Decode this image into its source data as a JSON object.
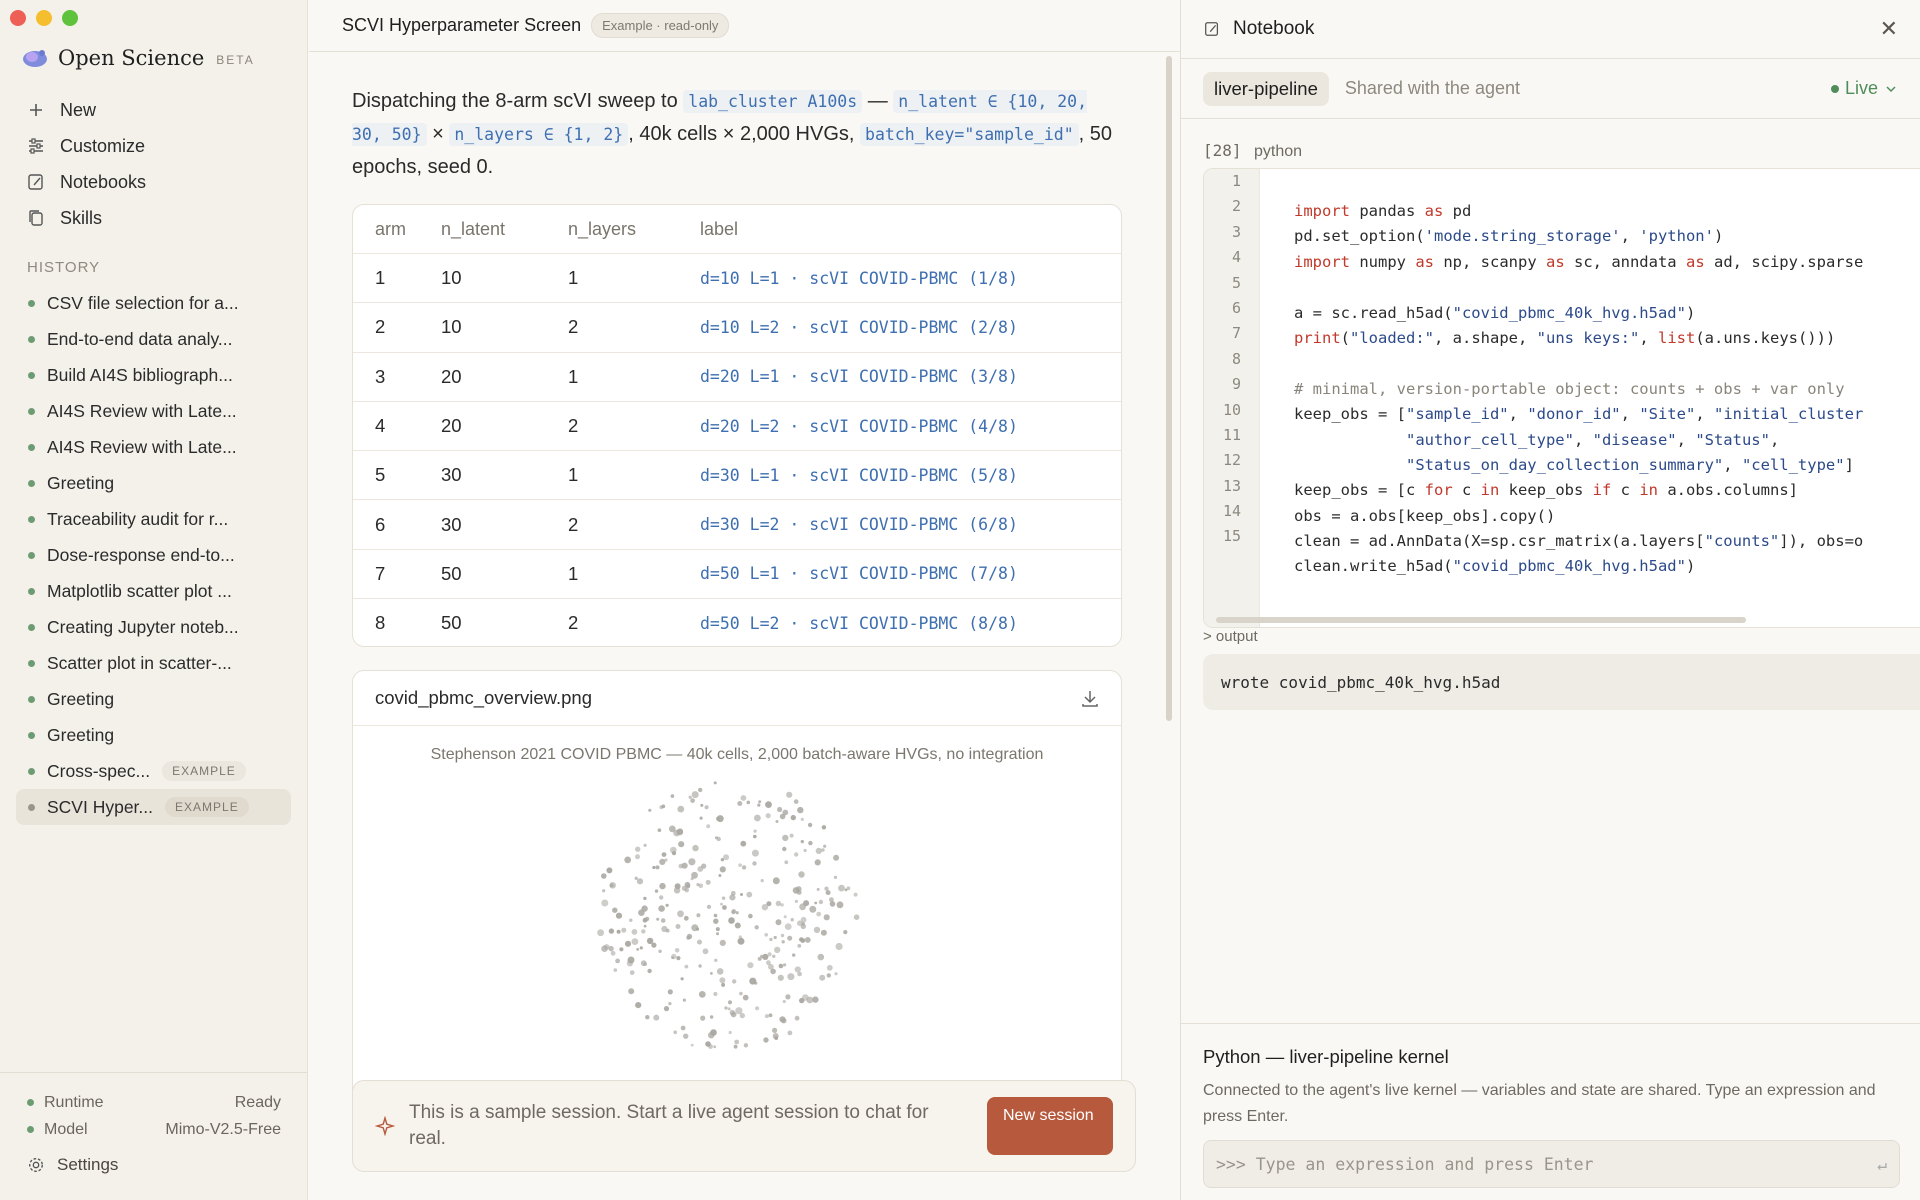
{
  "sidebar": {
    "brand": "Open Science",
    "brand_badge": "BETA",
    "nav": {
      "new": "New",
      "customize": "Customize",
      "notebooks": "Notebooks",
      "skills": "Skills"
    },
    "history_title": "HISTORY",
    "history": [
      {
        "label": "CSV file selection for a...",
        "tag": ""
      },
      {
        "label": "End-to-end data analy...",
        "tag": ""
      },
      {
        "label": "Build AI4S bibliograph...",
        "tag": ""
      },
      {
        "label": "AI4S Review with Late...",
        "tag": ""
      },
      {
        "label": "AI4S Review with Late...",
        "tag": ""
      },
      {
        "label": "Greeting",
        "tag": ""
      },
      {
        "label": "Traceability audit for r...",
        "tag": ""
      },
      {
        "label": "Dose-response end-to...",
        "tag": ""
      },
      {
        "label": "Matplotlib scatter plot ...",
        "tag": ""
      },
      {
        "label": "Creating Jupyter noteb...",
        "tag": ""
      },
      {
        "label": "Scatter plot in scatter-...",
        "tag": ""
      },
      {
        "label": "Greeting",
        "tag": ""
      },
      {
        "label": "Greeting",
        "tag": ""
      },
      {
        "label": "Cross-spec...",
        "tag": "EXAMPLE"
      },
      {
        "label": "SCVI Hyper...",
        "tag": "EXAMPLE"
      }
    ],
    "status": {
      "runtime_label": "Runtime",
      "runtime_value": "Ready",
      "model_label": "Model",
      "model_value": "Mimo-V2.5-Free"
    },
    "settings": "Settings"
  },
  "main": {
    "title": "SCVI Hyperparameter Screen",
    "badge": "Example · read-only",
    "message": {
      "t1": "Dispatching the 8-arm scVI sweep to ",
      "c1": "lab_cluster A100s",
      "t2": " — ",
      "c2": "n_latent ∈ {10, 20, 30, 50}",
      "t3": " × ",
      "c3": "n_layers ∈ {1, 2}",
      "t4": ", 40k cells × 2,000 HVGs, ",
      "c4": "batch_key=\"sample_id\"",
      "t5": ", 50 epochs, seed 0."
    },
    "table": {
      "headers": [
        "arm",
        "n_latent",
        "n_layers",
        "label"
      ],
      "rows": [
        [
          "1",
          "10",
          "1",
          "d=10 L=1 · scVI COVID-PBMC (1/8)"
        ],
        [
          "2",
          "10",
          "2",
          "d=10 L=2 · scVI COVID-PBMC (2/8)"
        ],
        [
          "3",
          "20",
          "1",
          "d=20 L=1 · scVI COVID-PBMC (3/8)"
        ],
        [
          "4",
          "20",
          "2",
          "d=20 L=2 · scVI COVID-PBMC (4/8)"
        ],
        [
          "5",
          "30",
          "1",
          "d=30 L=1 · scVI COVID-PBMC (5/8)"
        ],
        [
          "6",
          "30",
          "2",
          "d=30 L=2 · scVI COVID-PBMC (6/8)"
        ],
        [
          "7",
          "50",
          "1",
          "d=50 L=1 · scVI COVID-PBMC (7/8)"
        ],
        [
          "8",
          "50",
          "2",
          "d=50 L=2 · scVI COVID-PBMC (8/8)"
        ]
      ]
    },
    "image": {
      "filename": "covid_pbmc_overview.png",
      "caption": "Stephenson 2021 COVID PBMC — 40k cells, 2,000 batch-aware HVGs, no integration"
    },
    "composer": {
      "text": "This is a sample session. Start a live agent session to chat for real.",
      "button": "New session"
    }
  },
  "notebook": {
    "title": "Notebook",
    "branch": "liver-pipeline",
    "shared": "Shared with the agent",
    "live": "Live",
    "cell_number": "[28]",
    "cell_lang": "python",
    "line_numbers": [
      "1",
      "2",
      "3",
      "4",
      "5",
      "6",
      "7",
      "8",
      "9",
      "10",
      "11",
      "12",
      "13",
      "14",
      "15"
    ],
    "code_lines": [
      "import pandas as pd",
      "pd.set_option('mode.string_storage', 'python')",
      "import numpy as np, scanpy as sc, anndata as ad, scipy.sparse",
      "",
      "a = sc.read_h5ad(\"covid_pbmc_40k_hvg.h5ad\")",
      "print(\"loaded:\", a.shape, \"uns keys:\", list(a.uns.keys()))",
      "",
      "# minimal, version-portable object: counts + obs + var only",
      "keep_obs = [\"sample_id\", \"donor_id\", \"Site\", \"initial_cluster",
      "            \"author_cell_type\", \"disease\", \"Status\",",
      "            \"Status_on_day_collection_summary\", \"cell_type\"]",
      "keep_obs = [c for c in keep_obs if c in a.obs.columns]",
      "obs = a.obs[keep_obs].copy()",
      "clean = ad.AnnData(X=sp.csr_matrix(a.layers[\"counts\"]), obs=o",
      "clean.write_h5ad(\"covid_pbmc_40k_hvg.h5ad\")"
    ],
    "output_label": "> output",
    "output": "wrote covid_pbmc_40k_hvg.h5ad",
    "kernel": {
      "title": "Python — liver-pipeline kernel",
      "desc": "Connected to the agent's live kernel — variables and state are shared. Type an expression and press Enter.",
      "placeholder": ">>> Type an expression and press Enter"
    }
  }
}
